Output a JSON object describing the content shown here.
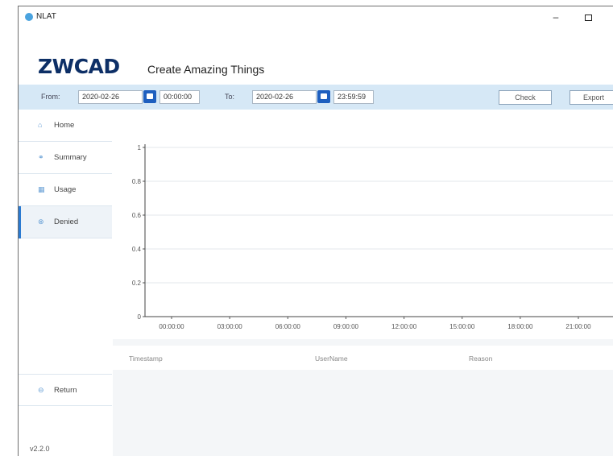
{
  "window": {
    "title": "NLAT"
  },
  "brand": {
    "logo": "ZWCAD",
    "tagline": "Create Amazing Things"
  },
  "filter": {
    "from_label": "From:",
    "from_date": "2020-02-26",
    "from_time": "00:00:00",
    "to_label": "To:",
    "to_date": "2020-02-26",
    "to_time": "23:59:59",
    "check_label": "Check",
    "export_label": "Export"
  },
  "sidebar": {
    "items": [
      {
        "label": "Home",
        "icon": "home-icon"
      },
      {
        "label": "Summary",
        "icon": "summary-icon"
      },
      {
        "label": "Usage",
        "icon": "usage-icon"
      },
      {
        "label": "Denied",
        "icon": "denied-icon",
        "active": true
      }
    ],
    "return_label": "Return",
    "version": "v2.2.0"
  },
  "chart_data": {
    "type": "line",
    "x_ticks": [
      "00:00:00",
      "03:00:00",
      "06:00:00",
      "09:00:00",
      "12:00:00",
      "15:00:00",
      "18:00:00",
      "21:00:00"
    ],
    "y_ticks": [
      "0",
      "0.2",
      "0.4",
      "0.6",
      "0.8",
      "1"
    ],
    "ylim": [
      0,
      1
    ],
    "grid": true,
    "series": []
  },
  "table": {
    "columns": [
      "Timestamp",
      "UserName",
      "Reason"
    ],
    "rows": []
  },
  "colors": {
    "accent": "#1e5fbf",
    "filter_bar": "#d6e8f6",
    "brand": "#0d2f66",
    "active_marker": "#2b7ad1"
  }
}
